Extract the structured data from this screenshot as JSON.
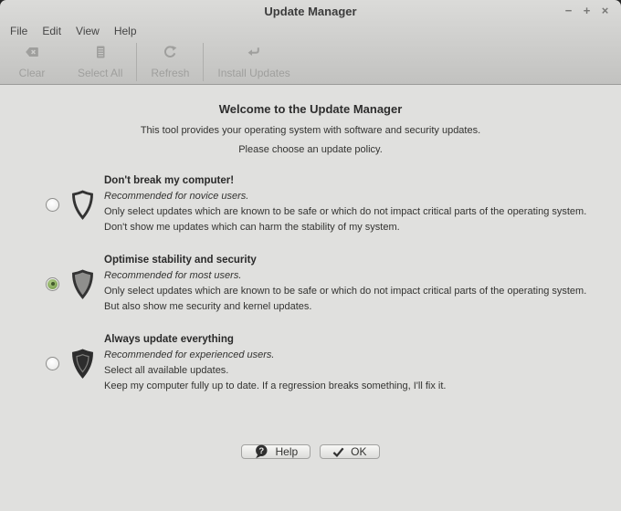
{
  "window": {
    "title": "Update Manager",
    "controls": {
      "minimize": "−",
      "maximize": "+",
      "close": "×"
    }
  },
  "menubar": {
    "items": [
      {
        "label": "File"
      },
      {
        "label": "Edit"
      },
      {
        "label": "View"
      },
      {
        "label": "Help"
      }
    ]
  },
  "toolbar": {
    "items": [
      {
        "label": "Clear",
        "icon": "clear-icon",
        "enabled": false
      },
      {
        "label": "Select All",
        "icon": "select-all-icon",
        "enabled": false
      },
      {
        "label": "Refresh",
        "icon": "refresh-icon",
        "enabled": false
      },
      {
        "label": "Install Updates",
        "icon": "install-updates-icon",
        "enabled": false
      }
    ]
  },
  "welcome": {
    "title": "Welcome to the Update Manager",
    "subtitle": "This tool provides your operating system with software and security updates.",
    "instruction": "Please choose an update policy."
  },
  "policies": [
    {
      "title": "Don't break my computer!",
      "recommendation": "Recommended for novice users.",
      "line1": "Only select updates which are known to be safe or which do not impact critical parts of the operating system.",
      "line2": "Don't show me updates which can harm the stability of my system.",
      "selected": false,
      "shield": "shield-outline-icon"
    },
    {
      "title": "Optimise stability and security",
      "recommendation": "Recommended for most users.",
      "line1": "Only select updates which are known to be safe or which do not impact critical parts of the operating system.",
      "line2": "But also show me security and kernel updates.",
      "selected": true,
      "shield": "shield-half-icon"
    },
    {
      "title": "Always update everything",
      "recommendation": "Recommended for experienced users.",
      "line1": "Select all available updates.",
      "line2": "Keep my computer fully up to date. If a regression breaks something, I'll fix it.",
      "selected": false,
      "shield": "shield-full-icon"
    }
  ],
  "buttons": {
    "help": {
      "label": "Help",
      "icon": "question-bubble-icon"
    },
    "ok": {
      "label": "OK",
      "icon": "check-icon"
    }
  },
  "colors": {
    "accent_green": "#7fa355",
    "content_bg": "#e0e0de",
    "chrome_bg": "#cccccb",
    "disabled_text": "#9f9f9d"
  }
}
